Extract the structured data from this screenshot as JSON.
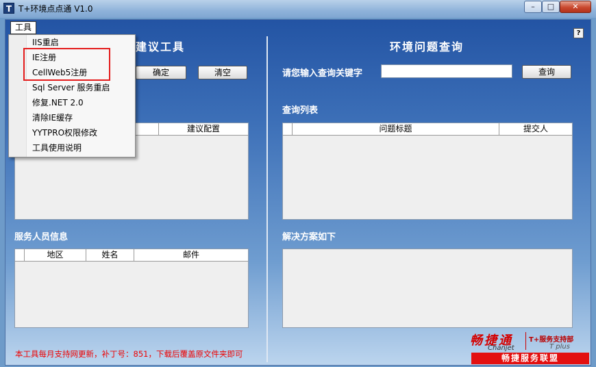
{
  "window": {
    "title": "T+环境点点通 V1.0",
    "app_icon": "T",
    "controls": {
      "minimize": "–",
      "maximize": "□",
      "close": "✕"
    }
  },
  "menu": {
    "tools_label": "工具",
    "items": [
      {
        "label": "IIS重启"
      },
      {
        "label": "IE注册"
      },
      {
        "label": "CellWeb5注册"
      },
      {
        "label": "Sql Server 服务重启"
      },
      {
        "label": "修复.NET 2.0"
      },
      {
        "label": "清除IE缓存"
      },
      {
        "label": "YYTPRO权限修改"
      },
      {
        "label": "工具使用说明"
      }
    ]
  },
  "help": {
    "icon": "?"
  },
  "left_panel": {
    "heading": "建议工具",
    "confirm_label": "确定",
    "clear_label": "清空",
    "grid_columns": [
      "建议配置"
    ],
    "staff_label": "服务人员信息",
    "staff_columns": [
      "地区",
      "姓名",
      "邮件"
    ]
  },
  "right_panel": {
    "heading": "环境问题查询",
    "search_label": "请您输入查询关键字",
    "search_value": "",
    "search_button": "查询",
    "list_label": "查询列表",
    "list_columns": [
      "问题标题",
      "提交人"
    ],
    "solution_label": "解决方案如下",
    "solution_text": ""
  },
  "footer_note": "本工具每月支持网更新，补丁号：851，下载后覆盖原文件夹即可",
  "logo": {
    "cn": "畅捷通",
    "en": "Chanjet",
    "tplus": "T+服务支持部",
    "tplus_en": "T plus",
    "union": "畅捷服务联盟"
  },
  "colors": {
    "highlight": "#e41a1a",
    "note": "#ee0000",
    "union_bg": "#e31010"
  }
}
